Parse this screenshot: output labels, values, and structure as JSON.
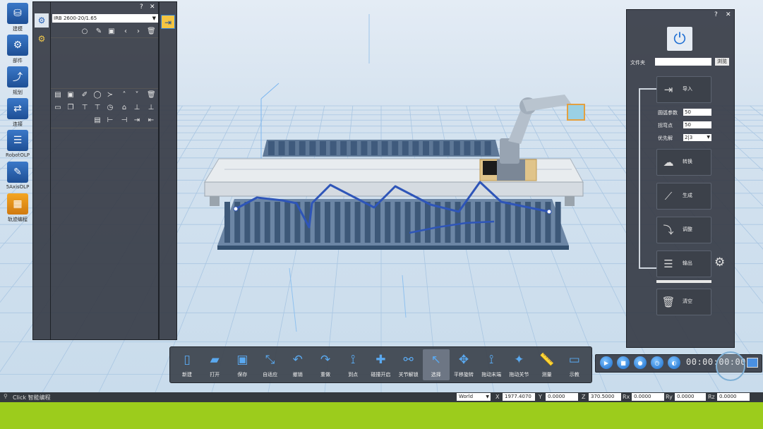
{
  "sidebar": {
    "items": [
      {
        "label": "建模",
        "icon": "model-icon"
      },
      {
        "label": "部件",
        "icon": "part-icon"
      },
      {
        "label": "规划",
        "icon": "plan-icon"
      },
      {
        "label": "连接",
        "icon": "connect-icon"
      },
      {
        "label": "RobotOLP",
        "icon": "robotolp-icon"
      },
      {
        "label": "5AxisOLP",
        "icon": "5axisolp-icon"
      },
      {
        "label": "轨迹编程",
        "icon": "trajectory-program-icon"
      }
    ]
  },
  "robot_panel": {
    "robot_select": "IRB 2600-20/1.65",
    "help": "?",
    "close": "✕"
  },
  "toolbar": {
    "buttons": [
      {
        "label": "新建",
        "icon": "new-file-icon"
      },
      {
        "label": "打开",
        "icon": "open-folder-icon"
      },
      {
        "label": "保存",
        "icon": "save-icon"
      },
      {
        "label": "自适应",
        "icon": "fit-view-icon"
      },
      {
        "label": "撤销",
        "icon": "undo-icon"
      },
      {
        "label": "重做",
        "icon": "redo-icon"
      },
      {
        "label": "到点",
        "icon": "to-point-icon"
      },
      {
        "label": "碰撞开启",
        "icon": "collision-icon"
      },
      {
        "label": "关节解锁",
        "icon": "joint-unlock-icon"
      },
      {
        "label": "选择",
        "icon": "select-icon"
      },
      {
        "label": "平移旋转",
        "icon": "translate-rotate-icon"
      },
      {
        "label": "拖动末端",
        "icon": "drag-end-icon"
      },
      {
        "label": "拖动关节",
        "icon": "drag-joint-icon"
      },
      {
        "label": "测量",
        "icon": "measure-icon"
      },
      {
        "label": "示教",
        "icon": "teach-icon"
      }
    ]
  },
  "right_panel": {
    "help": "?",
    "close": "✕",
    "folder_label": "文件夹",
    "folder_value": "",
    "browse_label": "浏览",
    "import_label": "导入",
    "params": [
      {
        "label": "圆弧参数",
        "value": "50"
      },
      {
        "label": "拐弯点",
        "value": "50"
      },
      {
        "label": "优先解",
        "value": "2|3"
      }
    ],
    "convert_label": "转换",
    "generate_label": "生成",
    "adjust_label": "调整",
    "output_label": "输出",
    "clear_label": "清空"
  },
  "playback": {
    "time_display": "00:00:00:00"
  },
  "statusbar": {
    "message": "Click 智能编程",
    "frame": "World",
    "x_label": "X",
    "x_value": "1977.4070",
    "y_label": "Y",
    "y_value": "0.0000",
    "z_label": "Z",
    "z_value": "370.5000",
    "rx_label": "Rx",
    "rx_value": "0.0000",
    "ry_label": "Ry",
    "ry_value": "0.0000",
    "rz_label": "Rz",
    "rz_value": "0.0000"
  },
  "colors": {
    "accent": "#2f86e0",
    "panel": "#3a3f48",
    "ground": "#9ccc1c",
    "pallet": "#4d6a8e"
  }
}
